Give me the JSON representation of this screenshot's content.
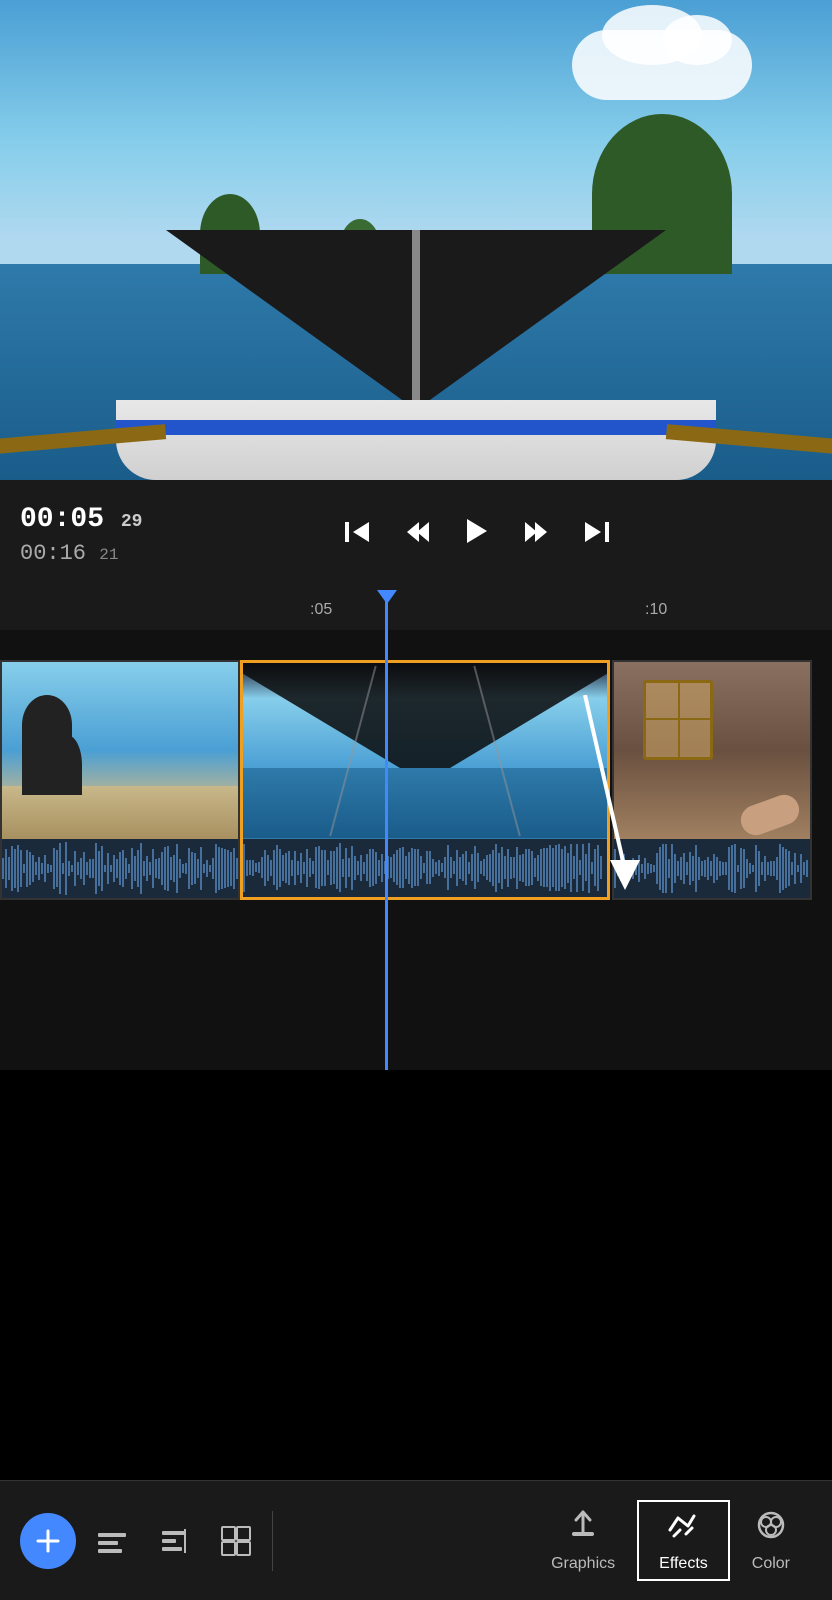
{
  "video": {
    "current_time": "00:05",
    "current_frame": "29",
    "total_time": "00:16",
    "total_frame": "21"
  },
  "timeline": {
    "marker_05": ":05",
    "marker_10": ":10"
  },
  "toolbar": {
    "add_label": "+",
    "nav_items": [
      {
        "id": "graphics",
        "label": "Graphics",
        "icon": "graphics-icon"
      },
      {
        "id": "effects",
        "label": "Effects",
        "icon": "effects-icon",
        "active": true
      },
      {
        "id": "color",
        "label": "Color",
        "icon": "color-icon"
      }
    ]
  },
  "icons": {
    "add": "+",
    "trim": "⊟",
    "align_left": "⊨",
    "layers": "⧉",
    "graphics_unicode": "⬆",
    "effects_unicode": "⇄",
    "color_unicode": "◎"
  }
}
